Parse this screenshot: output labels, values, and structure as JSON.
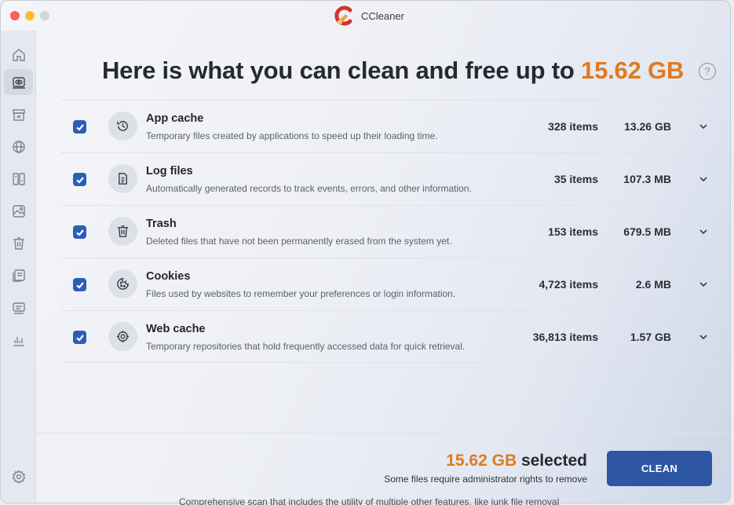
{
  "window": {
    "title": "CCleaner"
  },
  "sidebar": {
    "items": [
      {
        "icon": "home-icon",
        "active": false
      },
      {
        "icon": "scan-icon",
        "active": true
      },
      {
        "icon": "archive-icon",
        "active": false
      },
      {
        "icon": "globe-icon",
        "active": false
      },
      {
        "icon": "duplicates-icon",
        "active": false
      },
      {
        "icon": "image-icon",
        "active": false
      },
      {
        "icon": "trash-icon",
        "active": false
      },
      {
        "icon": "documents-icon",
        "active": false
      },
      {
        "icon": "monitor-icon",
        "active": false
      },
      {
        "icon": "stats-icon",
        "active": false
      }
    ],
    "settings_icon": "gear-icon"
  },
  "header": {
    "headline_prefix": "Here is what you can clean and free up to ",
    "headline_amount": "15.62 GB",
    "help_label": "?"
  },
  "categories": [
    {
      "title": "App cache",
      "description": "Temporary files created by applications to speed up their loading time.",
      "items": "328 items",
      "size": "13.26 GB",
      "checked": true,
      "icon": "history-icon"
    },
    {
      "title": "Log files",
      "description": "Automatically generated records to track events, errors, and other information.",
      "items": "35 items",
      "size": "107.3 MB",
      "checked": true,
      "icon": "document-icon"
    },
    {
      "title": "Trash",
      "description": "Deleted files that have not been permanently erased from the system yet.",
      "items": "153 items",
      "size": "679.5 MB",
      "checked": true,
      "icon": "trash-icon"
    },
    {
      "title": "Cookies",
      "description": "Files used by websites to remember your preferences or login information.",
      "items": "4,723 items",
      "size": "2.6 MB",
      "checked": true,
      "icon": "cookie-icon"
    },
    {
      "title": "Web cache",
      "description": "Temporary repositories that hold frequently accessed data for quick retrieval.",
      "items": "36,813 items",
      "size": "1.57 GB",
      "checked": true,
      "icon": "target-icon"
    }
  ],
  "footer": {
    "selected_amount": "15.62 GB",
    "selected_suffix": " selected",
    "note": "Some files require administrator rights to remove",
    "clean_label": "CLEAN"
  },
  "background_text": "Comprehensive scan that includes the utility of multiple other features, like junk file removal"
}
